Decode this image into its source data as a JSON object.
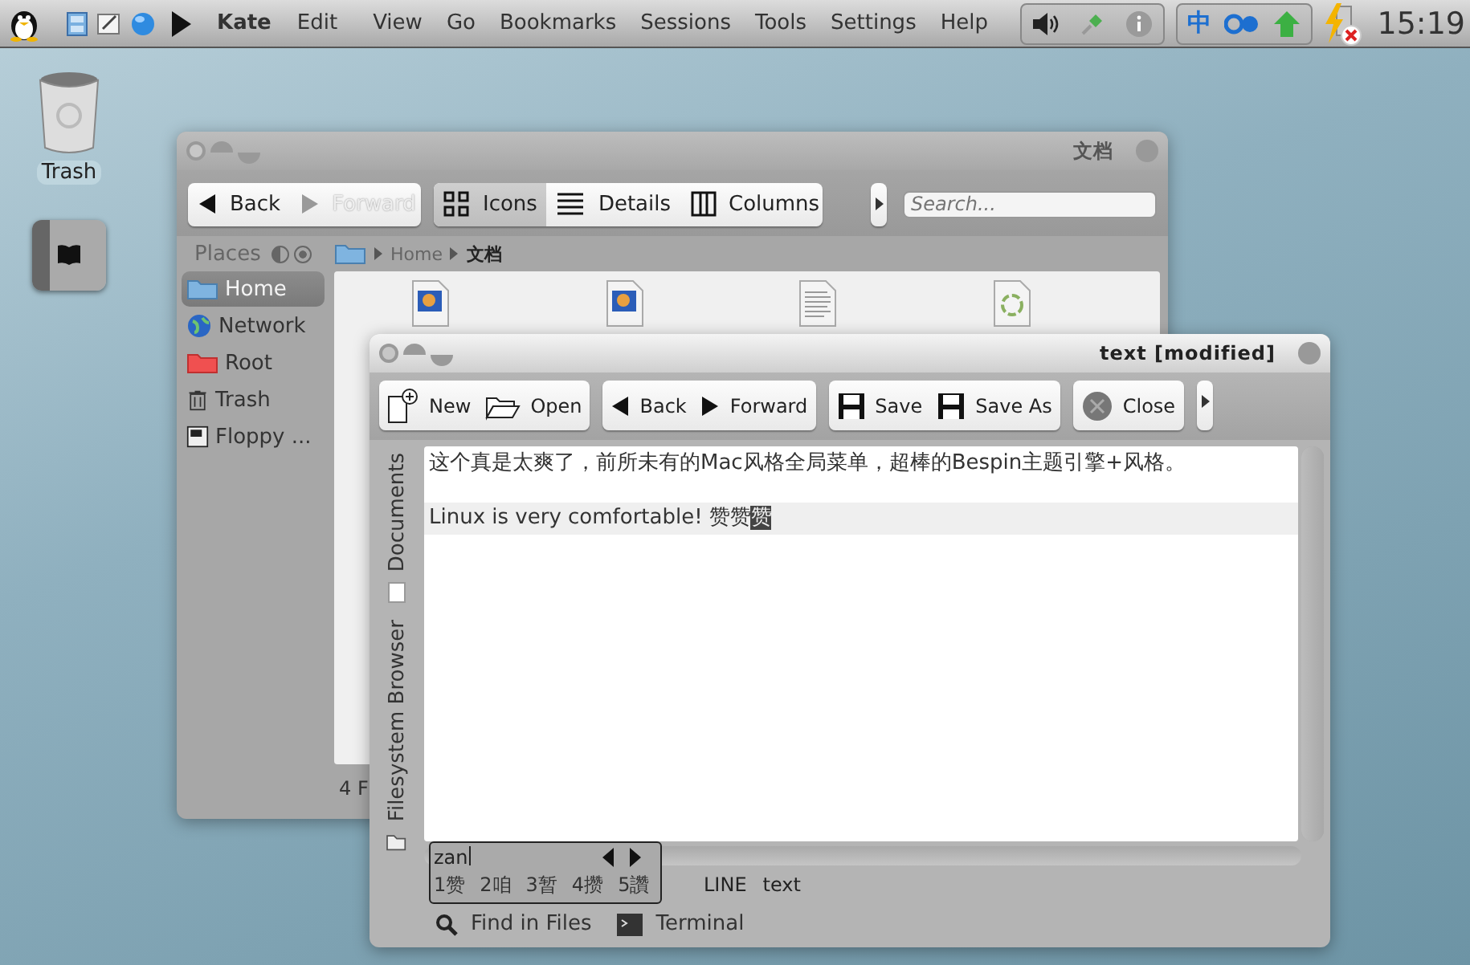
{
  "menubar": {
    "launchers": [
      {
        "kind": "penguin"
      },
      {
        "kind": "cabinet"
      },
      {
        "kind": "notepad"
      },
      {
        "kind": "globe"
      },
      {
        "kind": "play"
      }
    ],
    "app": "Kate",
    "menus": [
      "Edit",
      "View",
      "Go",
      "Bookmarks",
      "Sessions",
      "Tools",
      "Settings",
      "Help"
    ],
    "tray": [
      {
        "kind": "speaker"
      },
      {
        "kind": "pin"
      },
      {
        "kind": "info"
      }
    ],
    "input_tray": [
      {
        "kind": "zh",
        "text": "中"
      },
      {
        "kind": "dots"
      },
      {
        "kind": "arrow"
      }
    ],
    "clock": "15:19"
  },
  "desktop_icons": [
    {
      "kind": "trash",
      "label": "Trash"
    },
    {
      "kind": "book"
    }
  ],
  "file_manager": {
    "title": "文档",
    "nav": [
      {
        "kind": "back",
        "label": "Back",
        "disabled": false
      },
      {
        "kind": "forward",
        "label": "Forward",
        "disabled": true
      }
    ],
    "views": [
      {
        "kind": "icons",
        "label": "Icons",
        "selected": true
      },
      {
        "kind": "details",
        "label": "Details",
        "selected": false
      },
      {
        "kind": "columns",
        "label": "Columns",
        "selected": false
      }
    ],
    "search": {
      "placeholder": "Search..."
    },
    "places_header": "Places",
    "places": [
      {
        "kind": "home",
        "label": "Home",
        "selected": true
      },
      {
        "kind": "network",
        "label": "Network",
        "selected": false
      },
      {
        "kind": "root",
        "label": "Root",
        "selected": false
      },
      {
        "kind": "trash",
        "label": "Trash",
        "selected": false
      },
      {
        "kind": "floppy",
        "label": "Floppy ...",
        "selected": false
      }
    ],
    "breadcrumb": [
      {
        "label": "Home",
        "current": false
      },
      {
        "label": "文档",
        "current": true
      }
    ],
    "files": [
      {
        "kind": "png"
      },
      {
        "kind": "png"
      },
      {
        "kind": "text"
      },
      {
        "kind": "recycle"
      }
    ],
    "status": "4 F"
  },
  "kate": {
    "title": "text [modified]",
    "toolbar": [
      [
        {
          "kind": "new",
          "label": "New"
        },
        {
          "kind": "open",
          "label": "Open"
        }
      ],
      [
        {
          "kind": "back",
          "label": "Back"
        },
        {
          "kind": "forward",
          "label": "Forward"
        }
      ],
      [
        {
          "kind": "save",
          "label": "Save"
        },
        {
          "kind": "save",
          "label": "Save As"
        }
      ],
      [
        {
          "kind": "close",
          "label": "Close"
        }
      ]
    ],
    "side_tabs": [
      {
        "kind": "documents",
        "label": "Documents"
      },
      {
        "kind": "folder",
        "label": "Filesystem Browser"
      }
    ],
    "lines": [
      {
        "text": "这个真是太爽了，前所未有的Mac风格全局菜单，超棒的Bespin主题引擎+风格。",
        "current": false
      },
      {
        "text": "Linux is very comfortable! 赞赞",
        "preedit": "赞",
        "current": true
      }
    ],
    "ime": {
      "input": "zan",
      "candidates": [
        "1赞",
        "2咱",
        "3暂",
        "4攒",
        "5讚"
      ]
    },
    "status": [
      "LINE",
      "text"
    ],
    "bottom_tabs": [
      {
        "kind": "search",
        "label": "Find in Files"
      },
      {
        "kind": "terminal",
        "label": "Terminal"
      }
    ]
  }
}
